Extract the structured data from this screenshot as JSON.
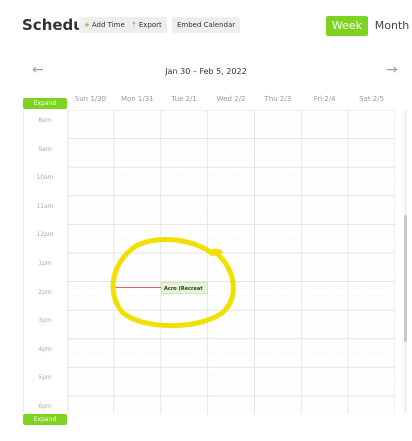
{
  "header": {
    "title": "Schedule",
    "add_time_label": "Add Time",
    "export_label": "Export",
    "embed_label": "Embed Calendar",
    "week_label": "Week",
    "month_label": "Month"
  },
  "icons": {
    "add_time": "+",
    "export": "⇡",
    "prev": "←",
    "next": "→"
  },
  "nav": {
    "range": "Jan 30 – Feb 5, 2022"
  },
  "calendar": {
    "expand_label": "Expand",
    "days": [
      "Sun 1/30",
      "Mon 1/31",
      "Tue 2/1",
      "Wed 2/2",
      "Thu 2/3",
      "Fri 2/4",
      "Sat 2/5"
    ],
    "hours": [
      "8am",
      "9am",
      "10am",
      "11am",
      "12pm",
      "1pm",
      "2pm",
      "3pm",
      "4pm",
      "5pm",
      "6pm"
    ]
  },
  "event": {
    "title": "Acro (Recreat"
  },
  "colors": {
    "accent": "#7ed321",
    "event_bg": "#e7f4d6",
    "event_line": "#e35d6a",
    "annotation": "#f2df00"
  }
}
